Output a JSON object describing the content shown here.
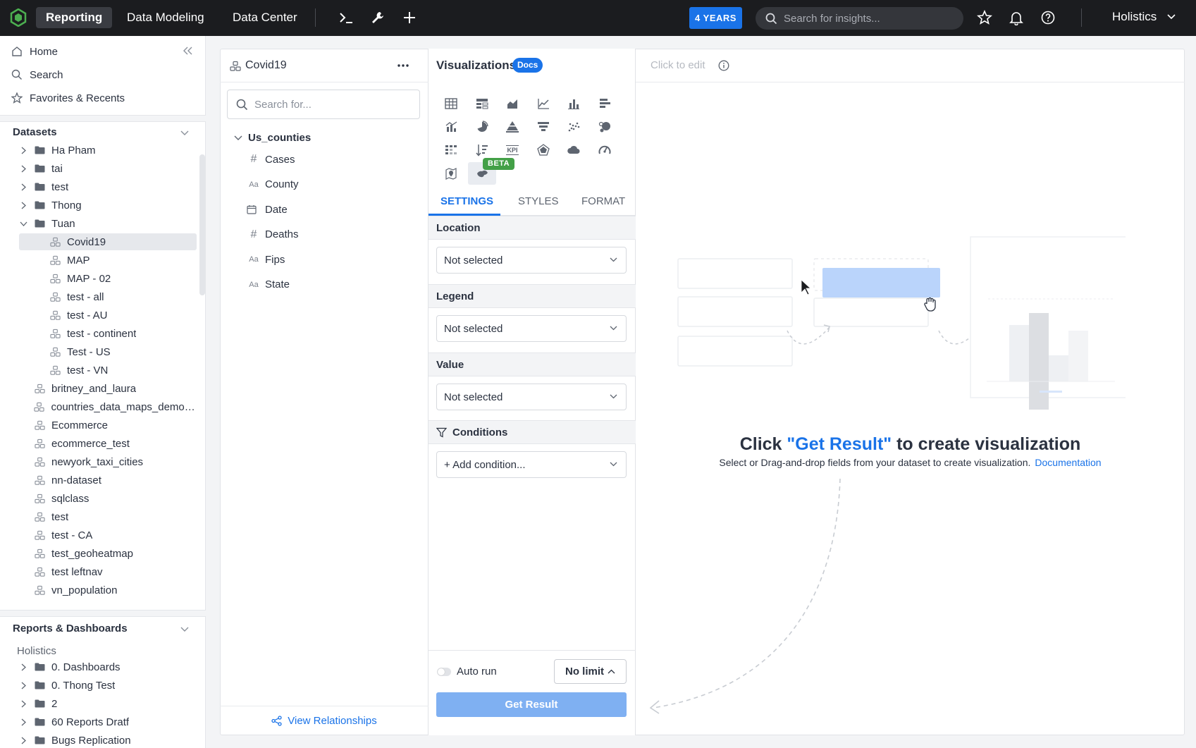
{
  "topbar": {
    "nav": [
      "Reporting",
      "Data Modeling",
      "Data Center"
    ],
    "years_badge": "4 YEARS",
    "search_placeholder": "Search for insights...",
    "user": "Holistics"
  },
  "sidebar": {
    "home": "Home",
    "search": "Search",
    "favorites": "Favorites & Recents",
    "datasets_title": "Datasets",
    "datasets": [
      {
        "label": "Ha Pham",
        "type": "folder",
        "expanded": false,
        "level": 0
      },
      {
        "label": "tai",
        "type": "folder",
        "expanded": false,
        "level": 0
      },
      {
        "label": "test",
        "type": "folder",
        "expanded": false,
        "level": 0
      },
      {
        "label": "Thong",
        "type": "folder",
        "expanded": false,
        "level": 0
      },
      {
        "label": "Tuan",
        "type": "folder",
        "expanded": true,
        "level": 0
      },
      {
        "label": "Covid19",
        "type": "dataset",
        "level": 1,
        "selected": true
      },
      {
        "label": "MAP",
        "type": "dataset",
        "level": 1
      },
      {
        "label": "MAP - 02",
        "type": "dataset",
        "level": 1
      },
      {
        "label": "test - all",
        "type": "dataset",
        "level": 1
      },
      {
        "label": "test - AU",
        "type": "dataset",
        "level": 1
      },
      {
        "label": "test - continent",
        "type": "dataset",
        "level": 1
      },
      {
        "label": "Test - US",
        "type": "dataset",
        "level": 1
      },
      {
        "label": "test - VN",
        "type": "dataset",
        "level": 1
      },
      {
        "label": "britney_and_laura",
        "type": "dataset",
        "level": 0
      },
      {
        "label": "countries_data_maps_demo_...",
        "type": "dataset",
        "level": 0
      },
      {
        "label": "Ecommerce",
        "type": "dataset",
        "level": 0
      },
      {
        "label": "ecommerce_test",
        "type": "dataset",
        "level": 0
      },
      {
        "label": "newyork_taxi_cities",
        "type": "dataset",
        "level": 0
      },
      {
        "label": "nn-dataset",
        "type": "dataset",
        "level": 0
      },
      {
        "label": "sqlclass",
        "type": "dataset",
        "level": 0
      },
      {
        "label": "test",
        "type": "dataset",
        "level": 0
      },
      {
        "label": "test - CA",
        "type": "dataset",
        "level": 0
      },
      {
        "label": "test_geoheatmap",
        "type": "dataset",
        "level": 0
      },
      {
        "label": "test leftnav",
        "type": "dataset",
        "level": 0
      },
      {
        "label": "vn_population",
        "type": "dataset",
        "level": 0
      }
    ],
    "reports_title": "Reports & Dashboards",
    "reports_owner": "Holistics",
    "reports": [
      {
        "label": "0. Dashboards"
      },
      {
        "label": "0. Thong Test"
      },
      {
        "label": "2"
      },
      {
        "label": "60 Reports Dratf"
      },
      {
        "label": "Bugs Replication"
      }
    ]
  },
  "dataset_panel": {
    "title": "Covid19",
    "search_placeholder": "Search for...",
    "model": "Us_counties",
    "fields": [
      {
        "type": "number",
        "badge": "#",
        "label": "Cases"
      },
      {
        "type": "text",
        "badge": "Aa",
        "label": "County"
      },
      {
        "type": "date",
        "badge": "date-icon",
        "label": "Date"
      },
      {
        "type": "number",
        "badge": "#",
        "label": "Deaths"
      },
      {
        "type": "text",
        "badge": "Aa",
        "label": "Fips"
      },
      {
        "type": "text",
        "badge": "Aa",
        "label": "State"
      }
    ],
    "view_relationships": "View Relationships"
  },
  "viz_panel": {
    "title": "Visualizations",
    "docs": "Docs",
    "beta": "BETA",
    "kpi_label": "KPI",
    "icons": [
      "table-icon",
      "pivot-table-icon",
      "area-chart-icon",
      "line-chart-icon",
      "column-chart-icon",
      "bar-chart-icon",
      "combination-chart-icon",
      "pie-chart-icon",
      "pyramid-chart-icon",
      "funnel-chart-icon",
      "scatter-chart-icon",
      "bubble-chart-icon",
      "conversion-funnel-icon",
      "sorted-list-icon",
      "kpi-metric-icon",
      "radar-chart-icon",
      "word-cloud-icon",
      "gauge-icon",
      "point-map-icon",
      "geo-heatmap-icon"
    ],
    "tabs": [
      "SETTINGS",
      "STYLES",
      "FORMAT"
    ],
    "active_tab": "SETTINGS",
    "location_label": "Location",
    "location_value": "Not selected",
    "legend_label": "Legend",
    "legend_value": "Not selected",
    "value_label": "Value",
    "value_value": "Not selected",
    "conditions_label": "Conditions",
    "add_condition": "+ Add condition...",
    "auto_run": "Auto run",
    "limit": "No limit",
    "get_result": "Get Result"
  },
  "canvas": {
    "click_to_edit": "Click to edit",
    "headline_prefix": "Click ",
    "headline_highlight": "\"Get Result\"",
    "headline_suffix": " to create visualization",
    "subline": "Select or Drag-and-drop fields from your dataset to create visualization.",
    "doc_link": "Documentation"
  },
  "colors": {
    "accent": "#1a73e8",
    "topbar": "#1b1c1f",
    "beta": "#43a047",
    "get_result_disabled": "#7fb0f2"
  }
}
